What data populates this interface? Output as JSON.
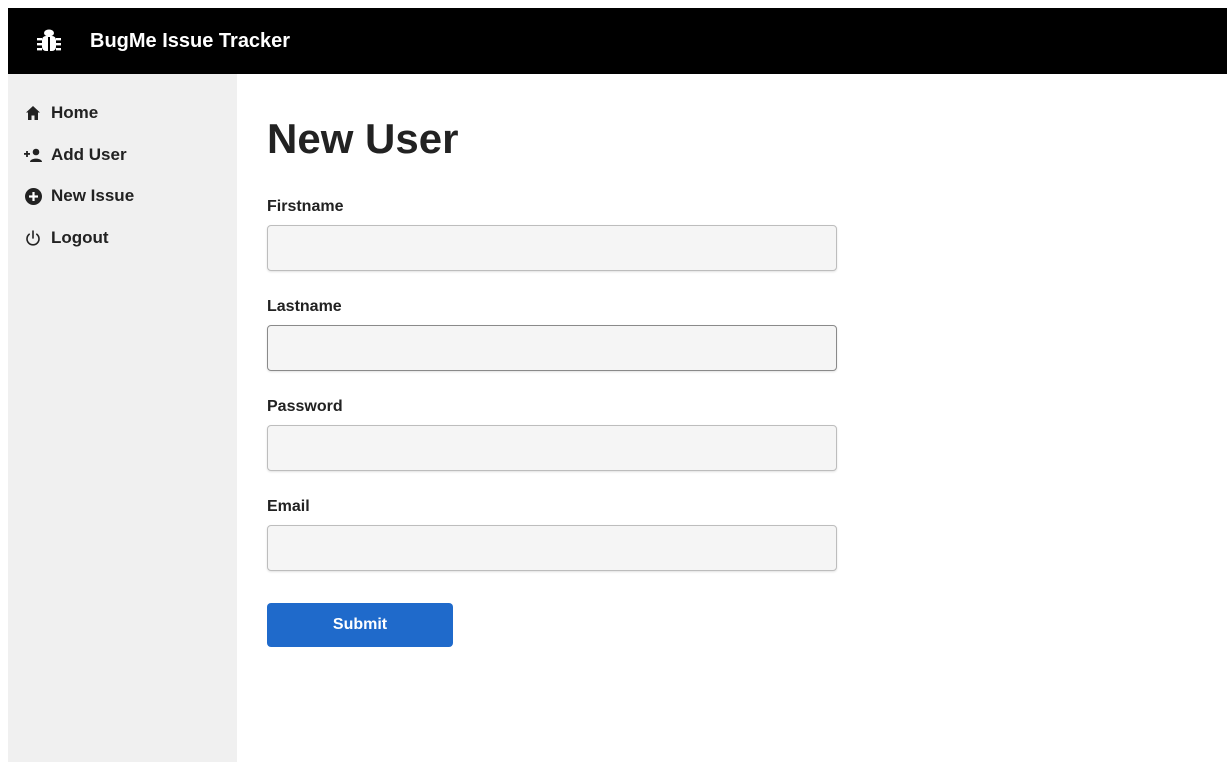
{
  "header": {
    "title": "BugMe Issue Tracker",
    "icon": "bug-icon",
    "background": "#000000"
  },
  "sidebar": {
    "items": [
      {
        "label": "Home",
        "icon": "home-icon"
      },
      {
        "label": "Add User",
        "icon": "add-user-icon"
      },
      {
        "label": "New Issue",
        "icon": "plus-circle-icon"
      },
      {
        "label": "Logout",
        "icon": "power-icon"
      }
    ],
    "background": "#f0f0f0"
  },
  "main": {
    "title": "New User",
    "form": {
      "fields": [
        {
          "label": "Firstname",
          "value": "",
          "type": "text"
        },
        {
          "label": "Lastname",
          "value": "",
          "type": "text"
        },
        {
          "label": "Password",
          "value": "",
          "type": "password"
        },
        {
          "label": "Email",
          "value": "",
          "type": "email"
        }
      ],
      "submit_label": "Submit",
      "submit_color": "#1f6acb"
    }
  }
}
